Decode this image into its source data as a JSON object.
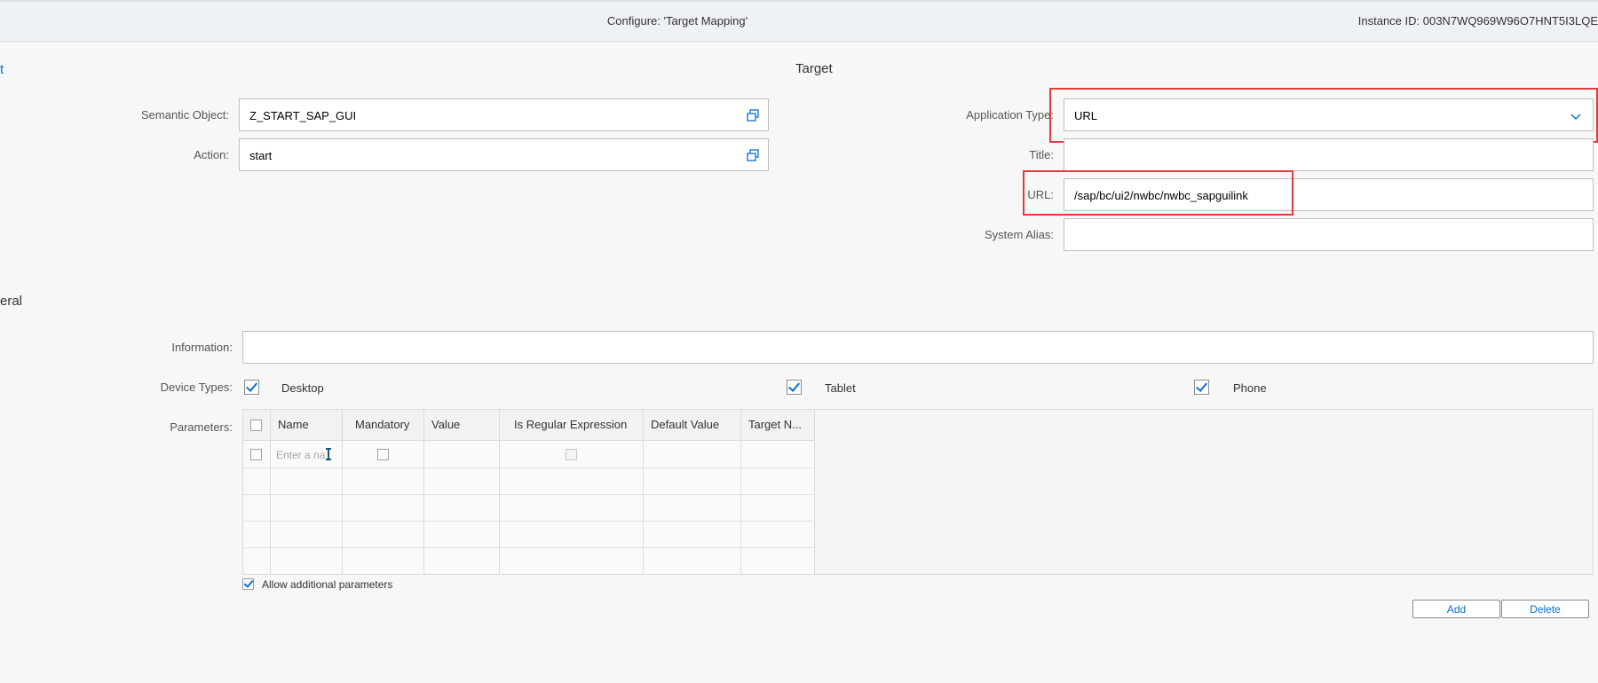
{
  "header": {
    "title": "Configure: 'Target Mapping'",
    "instance_id": "Instance ID: 003N7WQ969W96O7HNT5I3LQE"
  },
  "left_link_fragment": "t",
  "target_section": {
    "heading": "Target",
    "semantic_object": {
      "label": "Semantic Object:",
      "value": "Z_START_SAP_GUI"
    },
    "action": {
      "label": "Action:",
      "value": "start"
    },
    "application_type": {
      "label": "Application Type:",
      "value": "URL"
    },
    "title": {
      "label": "Title:",
      "value": ""
    },
    "url": {
      "label": "URL:",
      "value": "/sap/bc/ui2/nwbc/nwbc_sapguilink"
    },
    "system_alias": {
      "label": "System Alias:",
      "value": ""
    }
  },
  "general_section": {
    "heading_fragment": "eral",
    "information": {
      "label": "Information:",
      "value": ""
    },
    "device_types": {
      "label": "Device Types:",
      "desktop": {
        "label": "Desktop",
        "checked": true
      },
      "tablet": {
        "label": "Tablet",
        "checked": true
      },
      "phone": {
        "label": "Phone",
        "checked": true
      }
    },
    "parameters": {
      "label": "Parameters:",
      "columns": [
        "Name",
        "Mandatory",
        "Value",
        "Is Regular Expression",
        "Default Value",
        "Target N..."
      ],
      "first_row_placeholder": "Enter a na",
      "rows": 5
    },
    "allow_additional": {
      "label": "Allow additional parameters",
      "checked": true
    }
  },
  "buttons": {
    "add": "Add",
    "delete": "Delete"
  },
  "colors": {
    "accent": "#0a6ed1",
    "highlight": "#e03c3c"
  }
}
